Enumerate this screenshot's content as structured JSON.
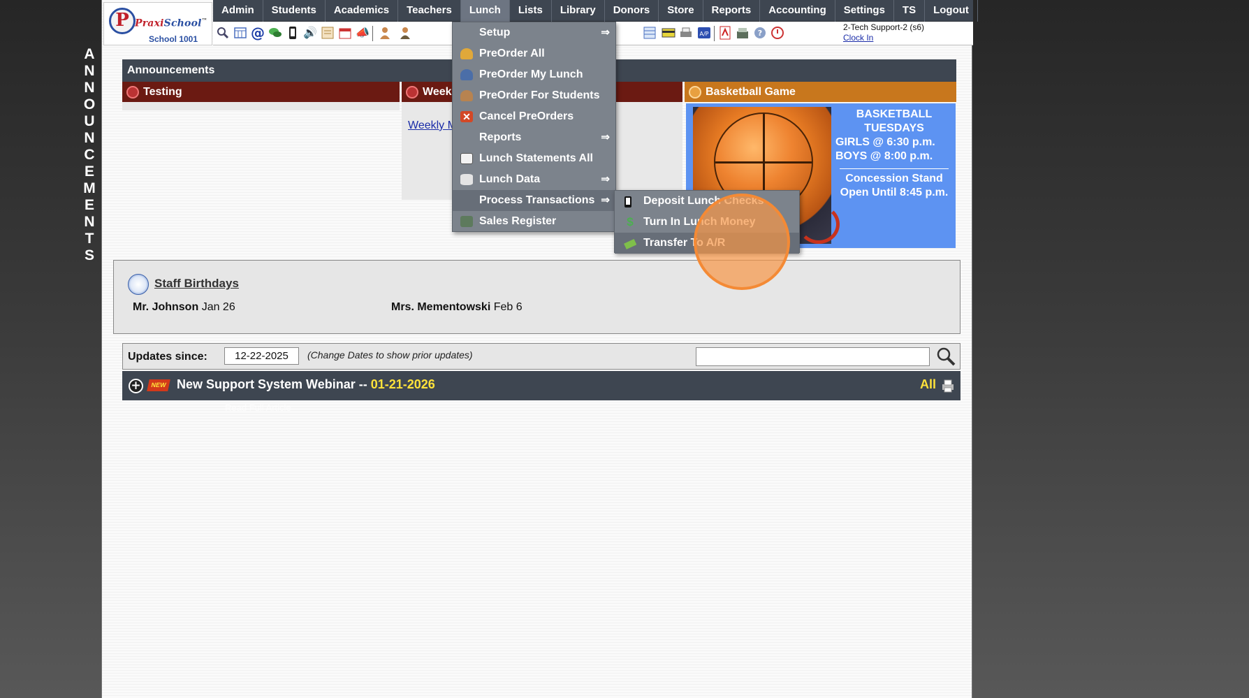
{
  "side_banner": [
    "A",
    "N",
    "N",
    "O",
    "U",
    "N",
    "C",
    "E",
    "M",
    "E",
    "N",
    "T",
    "S"
  ],
  "logo": {
    "mark": "P",
    "name_part1": "Praxi",
    "name_part2": "School",
    "tm": "™",
    "school": "School 1001"
  },
  "nav": [
    "Admin",
    "Students",
    "Academics",
    "Teachers",
    "Lunch",
    "Lists",
    "Library",
    "Donors",
    "Store",
    "Reports",
    "Accounting",
    "Settings",
    "TS",
    "Logout"
  ],
  "nav_active": "Lunch",
  "user": {
    "name": "2-Tech Support-2 (s6)",
    "clock_link": "Clock In"
  },
  "announcements": {
    "header": "Announcements",
    "col1_title": "Testing",
    "col2_title": "Weekly Menu",
    "col2_link": "Weekly Menu",
    "col3_title": "Basketball Game",
    "bball": {
      "line1": "BASKETBALL",
      "line2": "TUESDAYS",
      "line3": "GIRLS @ 6:30 p.m.",
      "line4": "BOYS  @ 8:00 p.m.",
      "line5": "Concession Stand",
      "line6": "Open Until 8:45 p.m."
    },
    "colors": {
      "testing": "#6b1a12",
      "weekly": "#6b1a12",
      "basketball": "#c8771d"
    }
  },
  "lunch_menu": {
    "items": [
      {
        "label": "Setup",
        "has_sub": true,
        "icon": "none"
      },
      {
        "label": "PreOrder All",
        "has_sub": false,
        "icon": "person-gold-icon"
      },
      {
        "label": "PreOrder My Lunch",
        "has_sub": false,
        "icon": "person-blue-icon"
      },
      {
        "label": "PreOrder For Students",
        "has_sub": false,
        "icon": "students-icon"
      },
      {
        "label": "Cancel PreOrders",
        "has_sub": false,
        "icon": "cancel-x-icon"
      },
      {
        "label": "Reports",
        "has_sub": true,
        "icon": "none"
      },
      {
        "label": "Lunch Statements All",
        "has_sub": false,
        "icon": "statement-icon"
      },
      {
        "label": "Lunch Data",
        "has_sub": true,
        "icon": "database-icon"
      },
      {
        "label": "Process Transactions",
        "has_sub": true,
        "icon": "none"
      },
      {
        "label": "Sales Register",
        "has_sub": false,
        "icon": "register-icon"
      }
    ],
    "arrow": "⇒",
    "highlighted": "Process Transactions"
  },
  "process_submenu": {
    "items": [
      {
        "label": "Deposit Lunch Checks",
        "icon": "phone-icon"
      },
      {
        "label": "Turn In Lunch Money",
        "icon": "dollar-icon"
      },
      {
        "label": "Transfer To A/R",
        "icon": "money-icon"
      }
    ],
    "highlighted": "Transfer To A/R"
  },
  "birthdays": {
    "title": "Staff Birthdays",
    "entries": [
      {
        "name": "Mr. Johnson",
        "date": "Jan 26"
      },
      {
        "name": "Mrs. Mementowski",
        "date": "Feb 6"
      }
    ]
  },
  "updates": {
    "label": "Updates since:",
    "date": "12-22-2025",
    "hint": "(Change Dates to show prior updates)",
    "search_value": ""
  },
  "webinar": {
    "badge": "NEW",
    "title": "New Support System Webinar -- ",
    "date": "01-21-2026",
    "all": "All"
  },
  "faded_text": "Read Full Article"
}
